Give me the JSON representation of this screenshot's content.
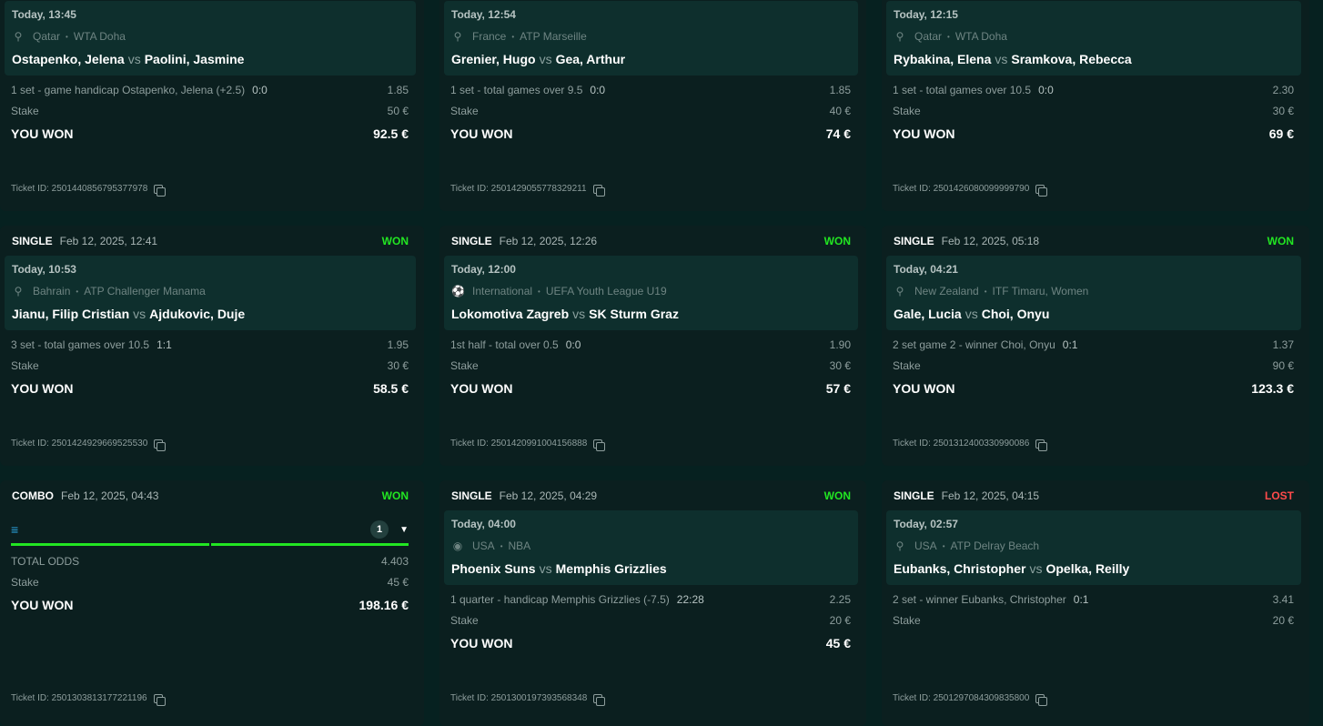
{
  "cards": [
    {
      "time": "Today, 13:45",
      "country": "Qatar",
      "league": "WTA Doha",
      "sport_icon": "tennis-icon",
      "home": "Ostapenko, Jelena",
      "away": "Paolini, Jasmine",
      "market": "1 set - game handicap Ostapenko, Jelena (+2.5)",
      "score": "0:0",
      "odds": "1.85",
      "stake_label": "Stake",
      "stake": "50 €",
      "result_label": "YOU WON",
      "payout": "92.5 €",
      "ticket": "Ticket ID: 2501440856795377978"
    },
    {
      "time": "Today, 12:54",
      "country": "France",
      "league": "ATP Marseille",
      "sport_icon": "tennis-icon",
      "home": "Grenier, Hugo",
      "away": "Gea, Arthur",
      "market": "1 set - total games over 9.5",
      "score": "0:0",
      "odds": "1.85",
      "stake_label": "Stake",
      "stake": "40 €",
      "result_label": "YOU WON",
      "payout": "74 €",
      "ticket": "Ticket ID: 2501429055778329211"
    },
    {
      "time": "Today, 12:15",
      "country": "Qatar",
      "league": "WTA Doha",
      "sport_icon": "tennis-icon",
      "home": "Rybakina, Elena",
      "away": "Sramkova, Rebecca",
      "market": "1 set - total games over 10.5",
      "score": "0:0",
      "odds": "2.30",
      "stake_label": "Stake",
      "stake": "30 €",
      "result_label": "YOU WON",
      "payout": "69 €",
      "ticket": "Ticket ID: 2501426080099999790"
    },
    {
      "type": "SINGLE",
      "date": "Feb 12, 2025, 12:41",
      "status": "WON",
      "time": "Today, 10:53",
      "country": "Bahrain",
      "league": "ATP Challenger Manama",
      "sport_icon": "tennis-icon",
      "home": "Jianu, Filip Cristian",
      "away": "Ajdukovic, Duje",
      "market": "3 set - total games over 10.5",
      "score": "1:1",
      "odds": "1.95",
      "stake_label": "Stake",
      "stake": "30 €",
      "result_label": "YOU WON",
      "payout": "58.5 €",
      "ticket": "Ticket ID: 2501424929669525530"
    },
    {
      "type": "SINGLE",
      "date": "Feb 12, 2025, 12:26",
      "status": "WON",
      "time": "Today, 12:00",
      "country": "International",
      "league": "UEFA Youth League U19",
      "sport_icon": "soccer-ball-icon",
      "home": "Lokomotiva Zagreb",
      "away": "SK Sturm Graz",
      "market": "1st half - total over 0.5",
      "score": "0:0",
      "odds": "1.90",
      "stake_label": "Stake",
      "stake": "30 €",
      "result_label": "YOU WON",
      "payout": "57 €",
      "ticket": "Ticket ID: 2501420991004156888"
    },
    {
      "type": "SINGLE",
      "date": "Feb 12, 2025, 05:18",
      "status": "WON",
      "time": "Today, 04:21",
      "country": "New Zealand",
      "league": "ITF Timaru, Women",
      "sport_icon": "tennis-icon",
      "home": "Gale, Lucia",
      "away": "Choi, Onyu",
      "market": "2 set game 2 - winner Choi, Onyu",
      "score": "0:1",
      "odds": "1.37",
      "stake_label": "Stake",
      "stake": "90 €",
      "result_label": "YOU WON",
      "payout": "123.3 €",
      "ticket": "Ticket ID: 2501312400330990086"
    },
    {
      "type": "COMBO",
      "date": "Feb 12, 2025, 04:43",
      "status": "WON",
      "combo_icon": "ticket-stack-icon",
      "selection_count": "1",
      "odds_label": "TOTAL ODDS",
      "odds": "4.403",
      "stake_label": "Stake",
      "stake": "45 €",
      "result_label": "YOU WON",
      "payout": "198.16 €",
      "ticket": "Ticket ID: 2501303813177221196"
    },
    {
      "type": "SINGLE",
      "date": "Feb 12, 2025, 04:29",
      "status": "WON",
      "time": "Today, 04:00",
      "country": "USA",
      "league": "NBA",
      "sport_icon": "basketball-icon",
      "home": "Phoenix Suns",
      "away": "Memphis Grizzlies",
      "market": "1 quarter - handicap Memphis Grizzlies (-7.5)",
      "score": "22:28",
      "odds": "2.25",
      "stake_label": "Stake",
      "stake": "20 €",
      "result_label": "YOU WON",
      "payout": "45 €",
      "ticket": "Ticket ID: 2501300197393568348"
    },
    {
      "type": "SINGLE",
      "date": "Feb 12, 2025, 04:15",
      "status": "LOST",
      "time": "Today, 02:57",
      "country": "USA",
      "league": "ATP Delray Beach",
      "sport_icon": "tennis-icon",
      "home": "Eubanks, Christopher",
      "away": "Opelka, Reilly",
      "market": "2 set - winner Eubanks, Christopher",
      "score": "0:1",
      "odds": "3.41",
      "stake_label": "Stake",
      "stake": "20 €",
      "ticket": "Ticket ID: 2501297084309835800"
    }
  ],
  "vs_label": "vs",
  "colors": {
    "won": "#22e622",
    "lost": "#ff4b4b",
    "background": "#062120",
    "card": "#0b1f1f",
    "event_panel": "#0e2f2d"
  }
}
